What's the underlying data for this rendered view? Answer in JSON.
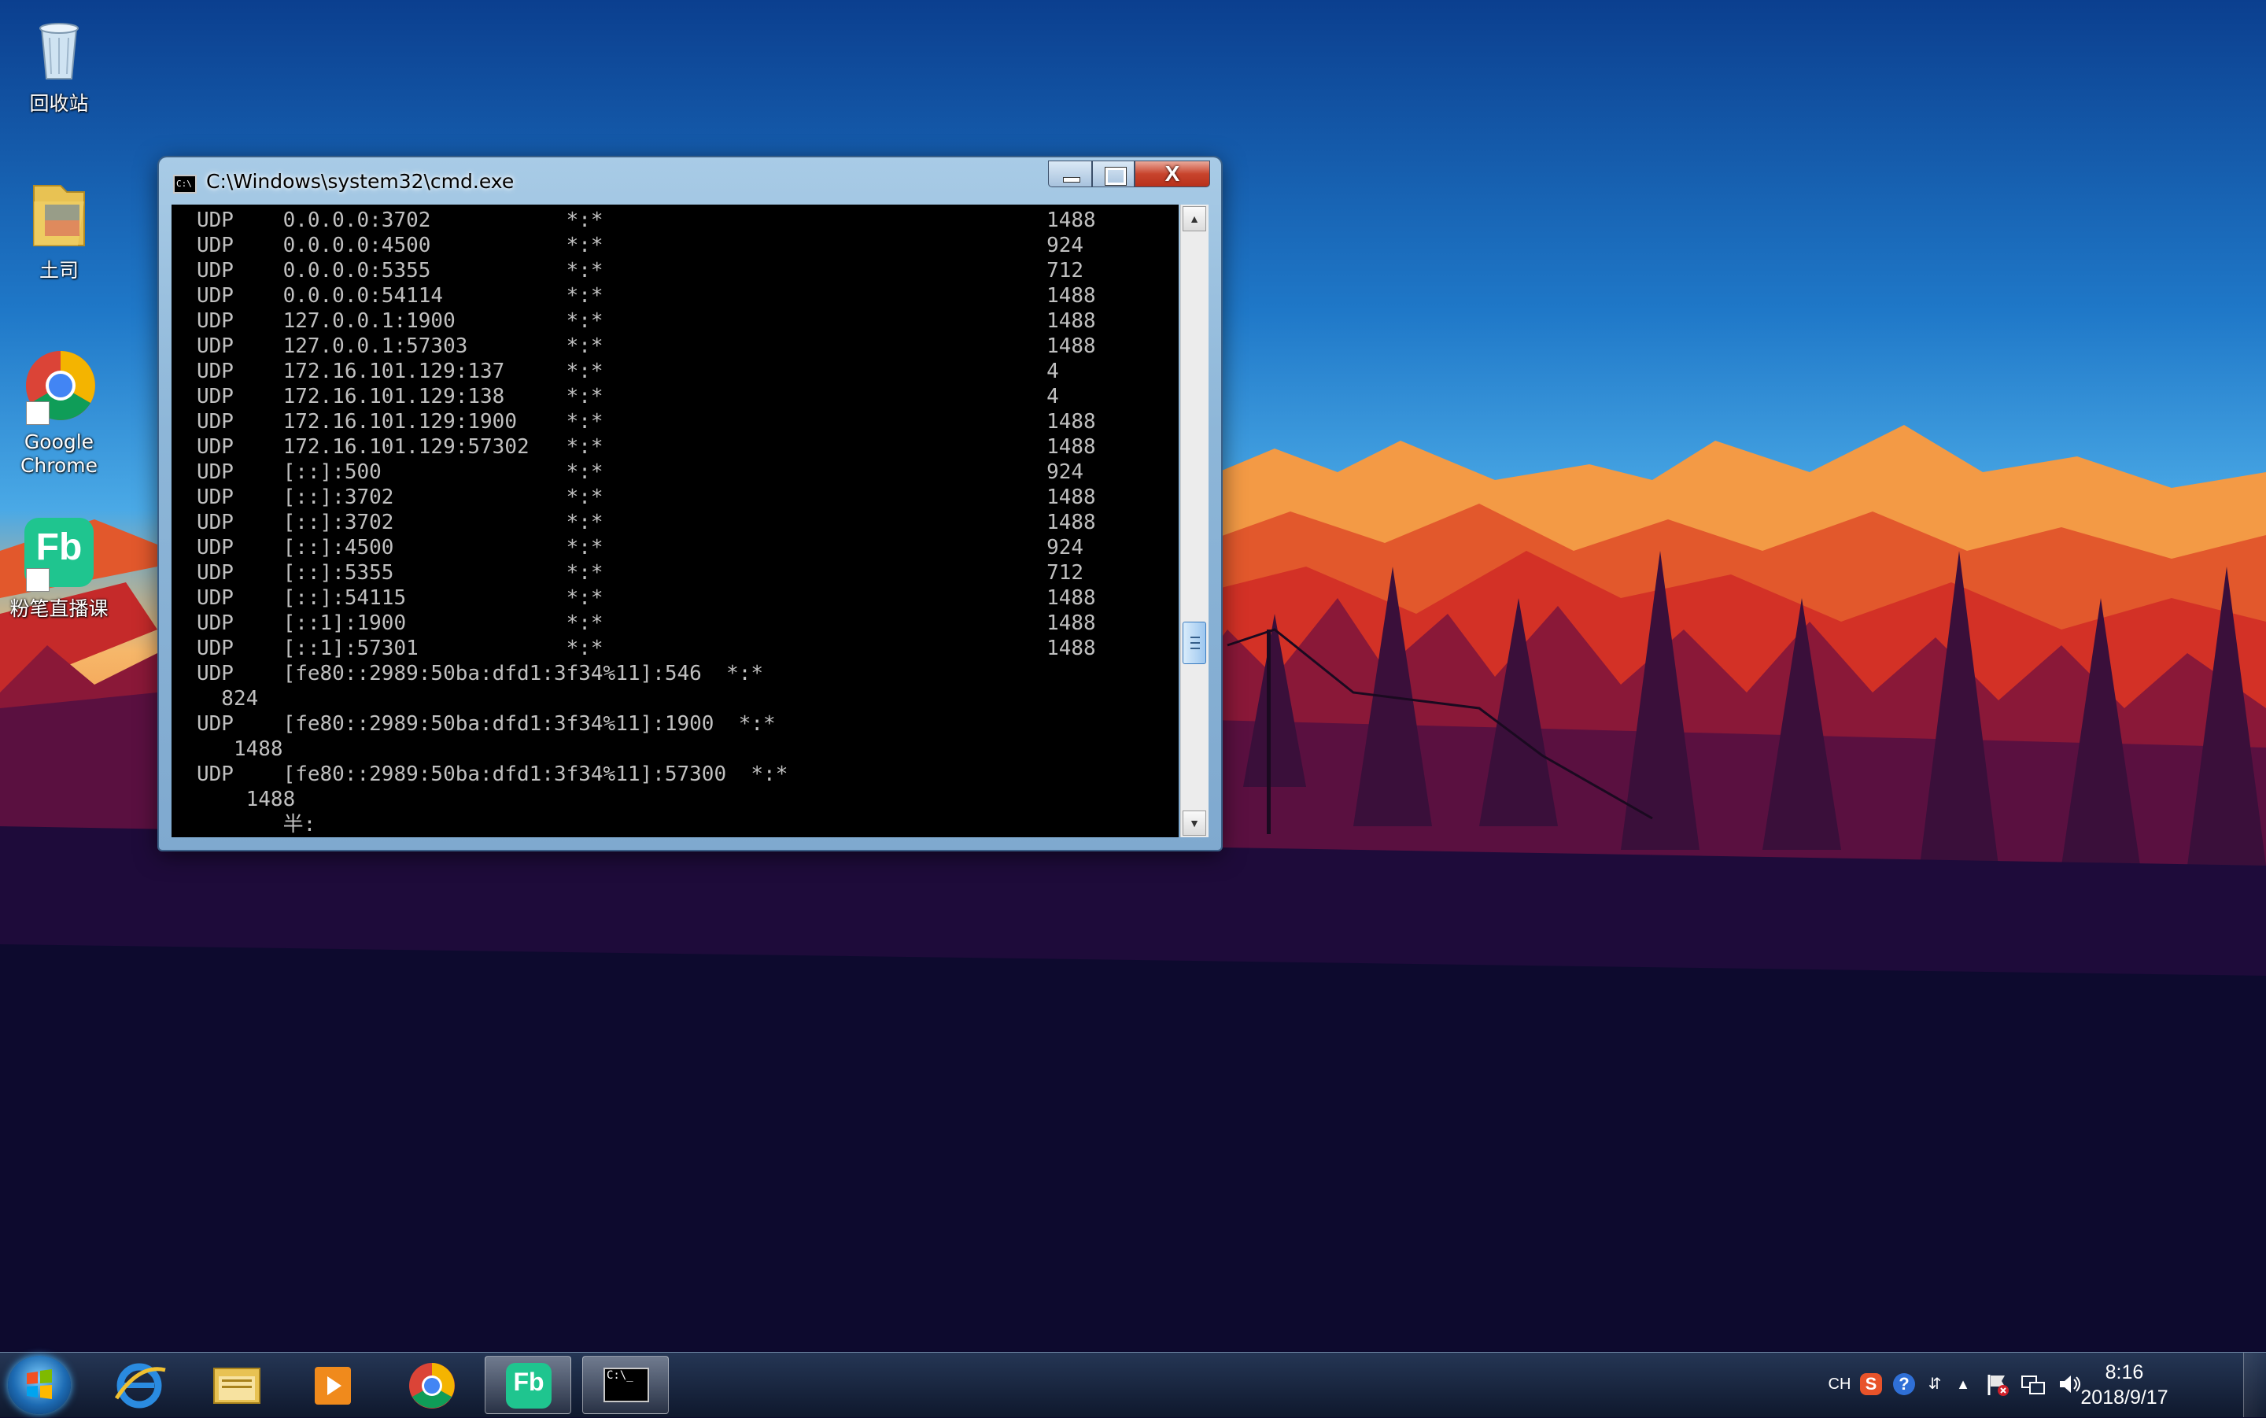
{
  "desktop": {
    "icons": [
      {
        "label": "回收站",
        "icon": "recycle-bin-icon"
      },
      {
        "label": "土司",
        "icon": "folder-icon"
      },
      {
        "label_line1": "Google",
        "label_line2": "Chrome",
        "icon": "chrome-icon"
      },
      {
        "label": "粉笔直播课",
        "icon": "fenbi-icon",
        "badge": "Fb"
      }
    ]
  },
  "cmd": {
    "title": "C:\\Windows\\system32\\cmd.exe",
    "app_icon_text": "C:\\",
    "close_label": "X",
    "output": "UDP    0.0.0.0:3702           *:*                                    1488\nUDP    0.0.0.0:4500           *:*                                    924\nUDP    0.0.0.0:5355           *:*                                    712\nUDP    0.0.0.0:54114          *:*                                    1488\nUDP    127.0.0.1:1900         *:*                                    1488\nUDP    127.0.0.1:57303        *:*                                    1488\nUDP    172.16.101.129:137     *:*                                    4\nUDP    172.16.101.129:138     *:*                                    4\nUDP    172.16.101.129:1900    *:*                                    1488\nUDP    172.16.101.129:57302   *:*                                    1488\nUDP    [::]:500               *:*                                    924\nUDP    [::]:3702              *:*                                    1488\nUDP    [::]:3702              *:*                                    1488\nUDP    [::]:4500              *:*                                    924\nUDP    [::]:5355              *:*                                    712\nUDP    [::]:54115             *:*                                    1488\nUDP    [::1]:1900             *:*                                    1488\nUDP    [::1]:57301            *:*                                    1488\nUDP    [fe80::2989:50ba:dfd1:3f34%11]:546  *:*\n  824\nUDP    [fe80::2989:50ba:dfd1:3f34%11]:1900  *:*\n   1488\nUDP    [fe80::2989:50ba:dfd1:3f34%11]:57300  *:*\n    1488\n       半:"
  },
  "taskbar": {
    "pinned": [
      "start-orb",
      "internet-explorer-icon",
      "file-explorer-icon",
      "media-player-icon",
      "chrome-icon",
      "fenbi-icon",
      "cmd-icon"
    ],
    "fenbi_badge": "Fb",
    "cmd_icon_text": "C:\\_",
    "tray": {
      "ime": "CH",
      "sogou": "S",
      "help": "?",
      "time": "8:16",
      "date": "2018/9/17"
    }
  },
  "colors": {
    "sky_top": "#0b3f8f",
    "sky_mid": "#2a8fd6",
    "sky_horizon": "#f6b76a",
    "mountain_far": "#f08a3a",
    "mountain_mid": "#d93a2a",
    "forest_dark": "#3a0f3a",
    "ground": "#0d0a2e",
    "console_bg": "#000000",
    "console_fg": "#c0c0c0"
  }
}
